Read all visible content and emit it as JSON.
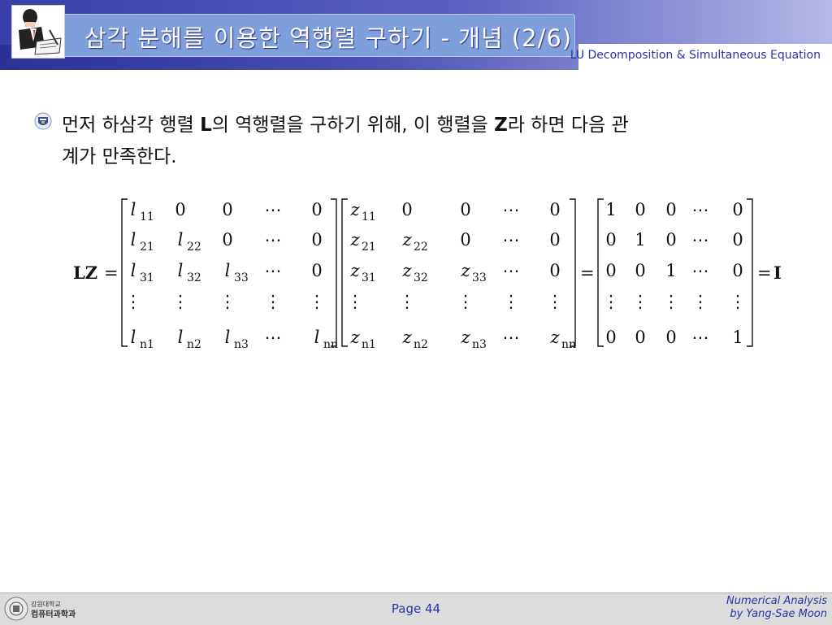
{
  "header": {
    "title": "삼각 분해를 이용한 역행렬 구하기 - 개념 (2/6)",
    "subtitle": "LU Decomposition & Simultaneous Equation"
  },
  "body": {
    "line1_a": "먼저 하삼각 행렬 ",
    "line1_b": "L",
    "line1_c": "의 역행렬을 구하기 위해, 이 행렬을 ",
    "line1_d": "Z",
    "line1_e": "라 하면 다음 관",
    "line2": "계가 만족한다."
  },
  "equation": {
    "lhs": "LZ",
    "eq": "=",
    "rhs": "I",
    "L_rows": [
      [
        [
          "l",
          "11"
        ],
        [
          "0",
          ""
        ],
        [
          "0",
          ""
        ],
        [
          "⋯",
          ""
        ],
        [
          "0",
          ""
        ]
      ],
      [
        [
          "l",
          "21"
        ],
        [
          "l",
          "22"
        ],
        [
          "0",
          ""
        ],
        [
          "⋯",
          ""
        ],
        [
          "0",
          ""
        ]
      ],
      [
        [
          "l",
          "31"
        ],
        [
          "l",
          "32"
        ],
        [
          "l",
          "33"
        ],
        [
          "⋯",
          ""
        ],
        [
          "0",
          ""
        ]
      ],
      [
        [
          "⋮",
          ""
        ],
        [
          "⋮",
          ""
        ],
        [
          "⋮",
          ""
        ],
        [
          "⋮",
          ""
        ],
        [
          "⋮",
          ""
        ]
      ],
      [
        [
          "l",
          "n1"
        ],
        [
          "l",
          "n2"
        ],
        [
          "l",
          "n3"
        ],
        [
          "⋯",
          ""
        ],
        [
          "l",
          "nn"
        ]
      ]
    ],
    "Z_rows": [
      [
        [
          "z",
          "11"
        ],
        [
          "0",
          ""
        ],
        [
          "0",
          ""
        ],
        [
          "⋯",
          ""
        ],
        [
          "0",
          ""
        ]
      ],
      [
        [
          "z",
          "21"
        ],
        [
          "z",
          "22"
        ],
        [
          "0",
          ""
        ],
        [
          "⋯",
          ""
        ],
        [
          "0",
          ""
        ]
      ],
      [
        [
          "z",
          "31"
        ],
        [
          "z",
          "32"
        ],
        [
          "z",
          "33"
        ],
        [
          "⋯",
          ""
        ],
        [
          "0",
          ""
        ]
      ],
      [
        [
          "⋮",
          ""
        ],
        [
          "⋮",
          ""
        ],
        [
          "⋮",
          ""
        ],
        [
          "⋮",
          ""
        ],
        [
          "⋮",
          ""
        ]
      ],
      [
        [
          "z",
          "n1"
        ],
        [
          "z",
          "n2"
        ],
        [
          "z",
          "n3"
        ],
        [
          "⋯",
          ""
        ],
        [
          "z",
          "nn"
        ]
      ]
    ],
    "I_rows": [
      [
        "1",
        "0",
        "0",
        "⋯",
        "0"
      ],
      [
        "0",
        "1",
        "0",
        "⋯",
        "0"
      ],
      [
        "0",
        "0",
        "1",
        "⋯",
        "0"
      ],
      [
        "⋮",
        "⋮",
        "⋮",
        "⋮",
        "⋮"
      ],
      [
        "0",
        "0",
        "0",
        "⋯",
        "1"
      ]
    ]
  },
  "footer": {
    "page": "Page 44",
    "course_line1": "Numerical Analysis",
    "course_line2": "by Yang-Sae Moon",
    "logo_text_1": "강원대학교",
    "logo_text_2": "컴퓨터과학과"
  },
  "colors": {
    "header_blue": "#3a3fa8",
    "title_box": "#7f9fdc",
    "accent_text": "#2833a6"
  },
  "icons": [
    "lecturer-clipart-icon",
    "university-emblem-icon",
    "bullet-emblem-icon"
  ]
}
